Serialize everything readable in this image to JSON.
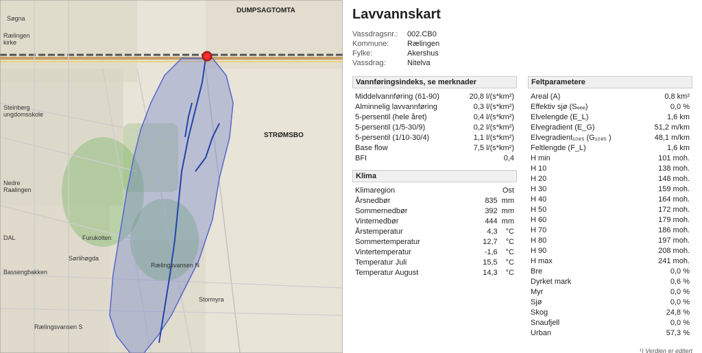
{
  "title": "Lavvannskart",
  "meta": {
    "vassdragsnr_label": "Vassdragsnr.:",
    "vassdragsnr_value": "002.CB0",
    "kommune_label": "Kommune:",
    "kommune_value": "Rælingen",
    "fylke_label": "Fylke:",
    "fylke_value": "Akershus",
    "vassdrag_label": "Vassdrag:",
    "vassdrag_value": "Nitelva"
  },
  "vannforingsindeks": {
    "title": "Vannføringsindeks, se merknader",
    "rows": [
      {
        "label": "Middelvannføring (61-90)",
        "value": "20,8 l/(s*km²)"
      },
      {
        "label": "Alminnelig lavvannføring",
        "value": "0,3 l/(s*km²)"
      },
      {
        "label": "5-persentil (hele året)",
        "value": "0,4 l/(s*km²)"
      },
      {
        "label": "5-persentil (1/5-30/9)",
        "value": "0,2 l/(s*km²)"
      },
      {
        "label": "5-persentil (1/10-30/4)",
        "value": "1,1 l/(s*km²)"
      },
      {
        "label": "Base flow",
        "value": "7,5 l/(s*km²)"
      },
      {
        "label": "BFI",
        "value": "0,4"
      }
    ]
  },
  "klima": {
    "title": "Klima",
    "rows": [
      {
        "label": "Klimaregion",
        "value": "Ost"
      },
      {
        "label": "Årsnedbør",
        "value": "835",
        "unit": "mm"
      },
      {
        "label": "Sommernedbør",
        "value": "392",
        "unit": "mm"
      },
      {
        "label": "Vinternedbør",
        "value": "444",
        "unit": "mm"
      },
      {
        "label": "Årstemperatur",
        "value": "4,3",
        "unit": "°C"
      },
      {
        "label": "Sommertemperatur",
        "value": "12,7",
        "unit": "°C"
      },
      {
        "label": "Vintertemperatur",
        "value": "-1,6",
        "unit": "°C"
      },
      {
        "label": "Temperatur Juli",
        "value": "15,5",
        "unit": "°C"
      },
      {
        "label": "Temperatur August",
        "value": "14,3",
        "unit": "°C"
      }
    ]
  },
  "feltparametere": {
    "title": "Feltparametere",
    "rows": [
      {
        "label": "Areal (A)",
        "value": "0,8 km²"
      },
      {
        "label": "Effektiv sjø (Sₑₑₑ)",
        "value": "0,0 %"
      },
      {
        "label": "Elvelengde (E_L)",
        "value": "1,6 km"
      },
      {
        "label": "Elvegradient (E_G)",
        "value": "51,2 m/km"
      },
      {
        "label": "Elvegradient₁₀₈₅ (G₁₀₈₅ )",
        "value": "48,1 m/km"
      },
      {
        "label": "Feltlengde (F_L)",
        "value": "1,6 km"
      },
      {
        "label": "H min",
        "value": "101 moh."
      },
      {
        "label": "H 10",
        "value": "138 moh."
      },
      {
        "label": "H 20",
        "value": "148 moh."
      },
      {
        "label": "H 30",
        "value": "159 moh."
      },
      {
        "label": "H 40",
        "value": "164 moh."
      },
      {
        "label": "H 50",
        "value": "172 moh."
      },
      {
        "label": "H 60",
        "value": "179 moh."
      },
      {
        "label": "H 70",
        "value": "186 moh."
      },
      {
        "label": "H 80",
        "value": "197 moh."
      },
      {
        "label": "H 90",
        "value": "208 moh."
      },
      {
        "label": "H max",
        "value": "241 moh."
      },
      {
        "label": "Bre",
        "value": "0,0 %"
      },
      {
        "label": "Dyrket mark",
        "value": "0,6 %"
      },
      {
        "label": "Myr",
        "value": "0,0 %"
      },
      {
        "label": "Sjø",
        "value": "0,0 %"
      },
      {
        "label": "Skog",
        "value": "24,8 %"
      },
      {
        "label": "Snaufjell",
        "value": "0,0 %"
      },
      {
        "label": "Urban",
        "value": "57,3 %"
      }
    ]
  },
  "footnote": "¹) Verdien er editert"
}
